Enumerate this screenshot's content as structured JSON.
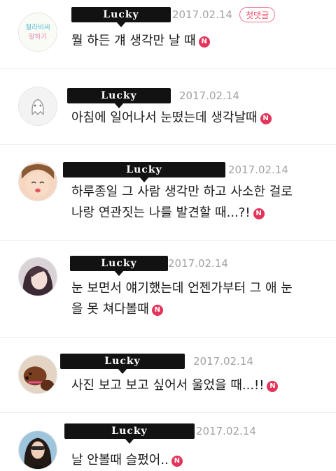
{
  "comments": [
    {
      "author": "Lucky",
      "date": "2017.02.14",
      "badge": "첫댓글",
      "lines": [
        "뭘 하든 걔 생각만 날 때"
      ],
      "new_icon": "N"
    },
    {
      "author": "Lucky",
      "date": "2017.02.14",
      "lines": [
        "아침에 일어나서 눈떴는데 생각날때"
      ],
      "new_icon": "N"
    },
    {
      "author": "Lucky",
      "date": "2017.02.14",
      "lines": [
        "하루종일 그 사람 생각만 하고 사소한 걸로",
        "나랑 연관짓는 나를 발견할 때...?!"
      ],
      "new_icon": "N"
    },
    {
      "author": "Lucky",
      "date": "2017.02.14",
      "lines": [
        "눈 보면서 얘기했는데 언젠가부터 그 애 눈",
        "을 못 쳐다볼때"
      ],
      "new_icon": "N"
    },
    {
      "author": "Lucky",
      "date": "2017.02.14",
      "lines": [
        "사진 보고 보고 싶어서 울었을 때...!!"
      ],
      "new_icon": "N"
    },
    {
      "author": "Lucky",
      "date": "2017.02.14",
      "lines": [
        "날 안볼때 슬펐어.."
      ],
      "new_icon": "N"
    }
  ],
  "avatar_text": [
    "절라비씨",
    "말하기"
  ],
  "colors": {
    "new_badge": "#e5345a",
    "first_comment_badge": "#ef4a68",
    "date": "#a3a3a3",
    "redaction_bar": "#121212"
  }
}
